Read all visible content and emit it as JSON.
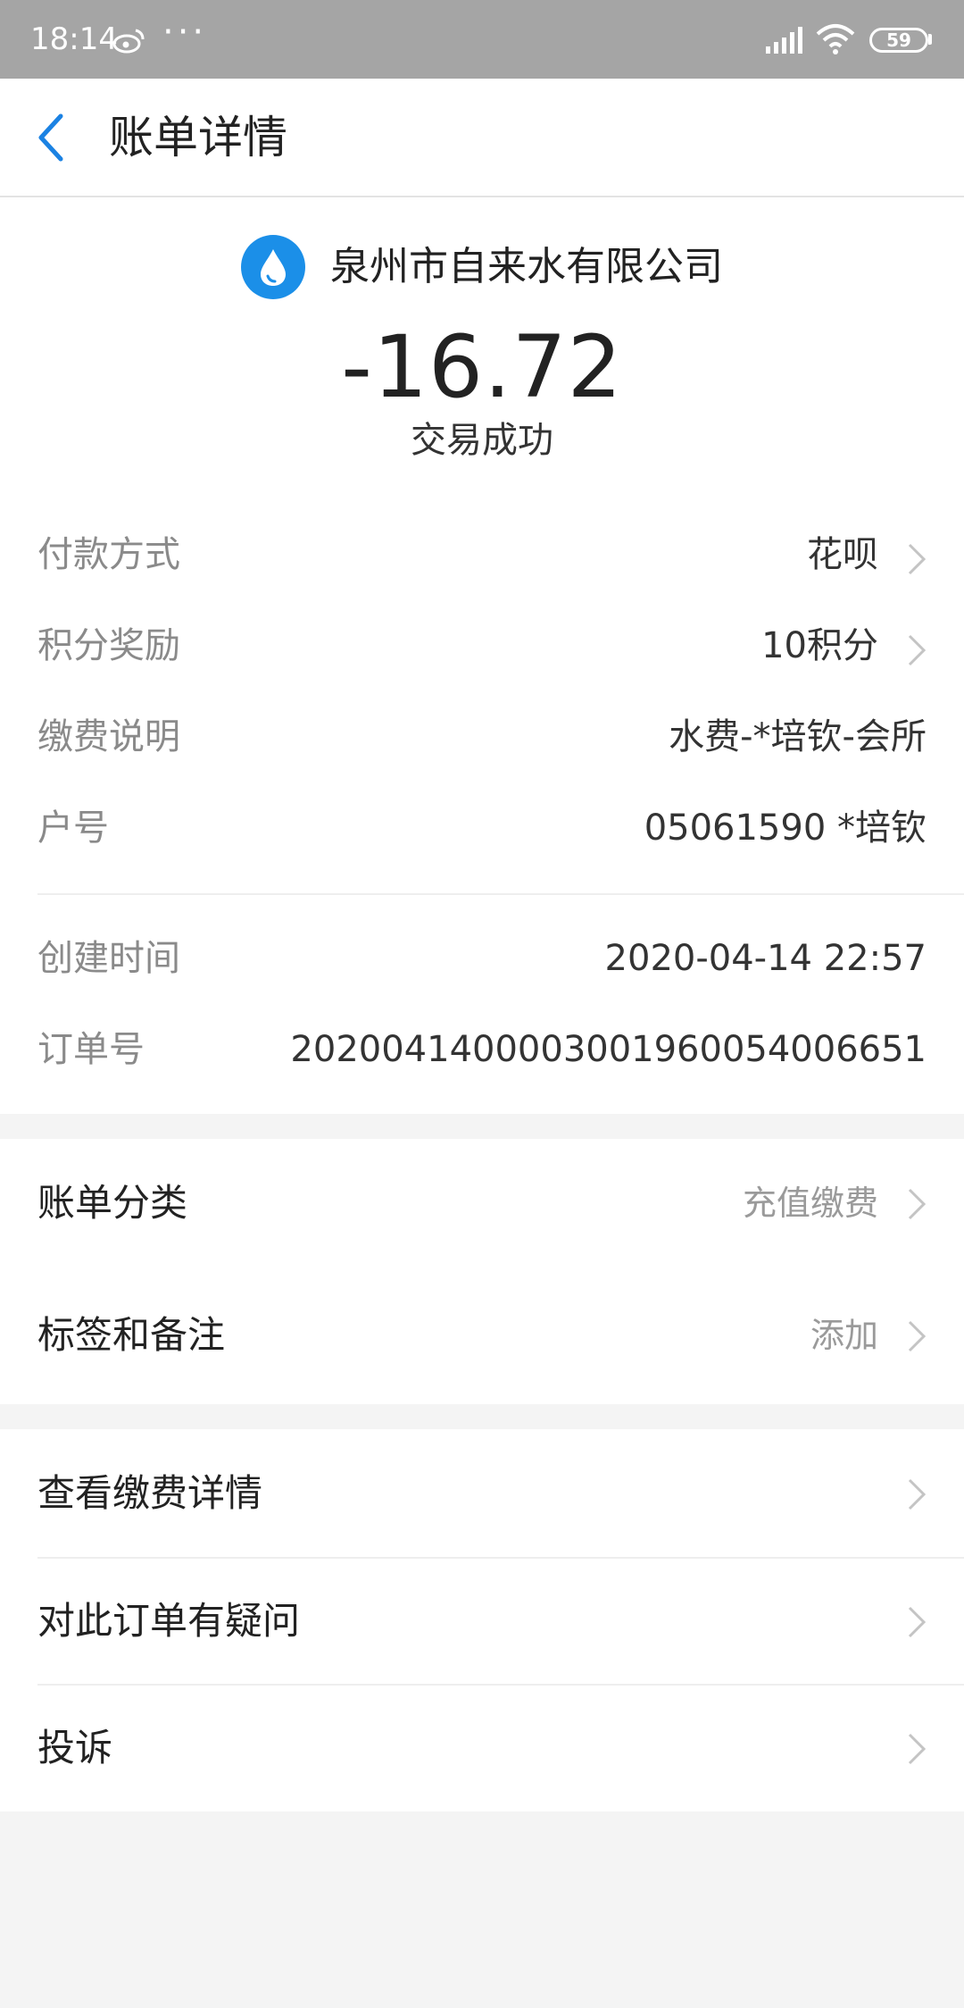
{
  "status_bar": {
    "time": "18:14",
    "more": "···",
    "battery": "59"
  },
  "nav": {
    "title": "账单详情"
  },
  "merchant": {
    "name": "泉州市自来水有限公司",
    "logo_color": "#1b8fe8"
  },
  "transaction": {
    "amount": "-16.72",
    "status": "交易成功"
  },
  "details": [
    {
      "label": "付款方式",
      "value": "花呗"
    },
    {
      "label": "积分奖励",
      "value": "10积分"
    },
    {
      "label": "缴费说明",
      "value": "水费-*培钦-会所"
    },
    {
      "label": "户号",
      "value": "05061590 *培钦"
    },
    {
      "label": "创建时间",
      "value": "2020-04-14 22:57"
    },
    {
      "label": "订单号",
      "value": "2020041400003001960054006651"
    }
  ],
  "category": {
    "label": "账单分类",
    "value": "充值缴费"
  },
  "tags": {
    "label": "标签和备注",
    "value": "添加"
  },
  "actions": [
    {
      "label": "查看缴费详情"
    },
    {
      "label": "对此订单有疑问"
    },
    {
      "label": "投诉"
    }
  ]
}
